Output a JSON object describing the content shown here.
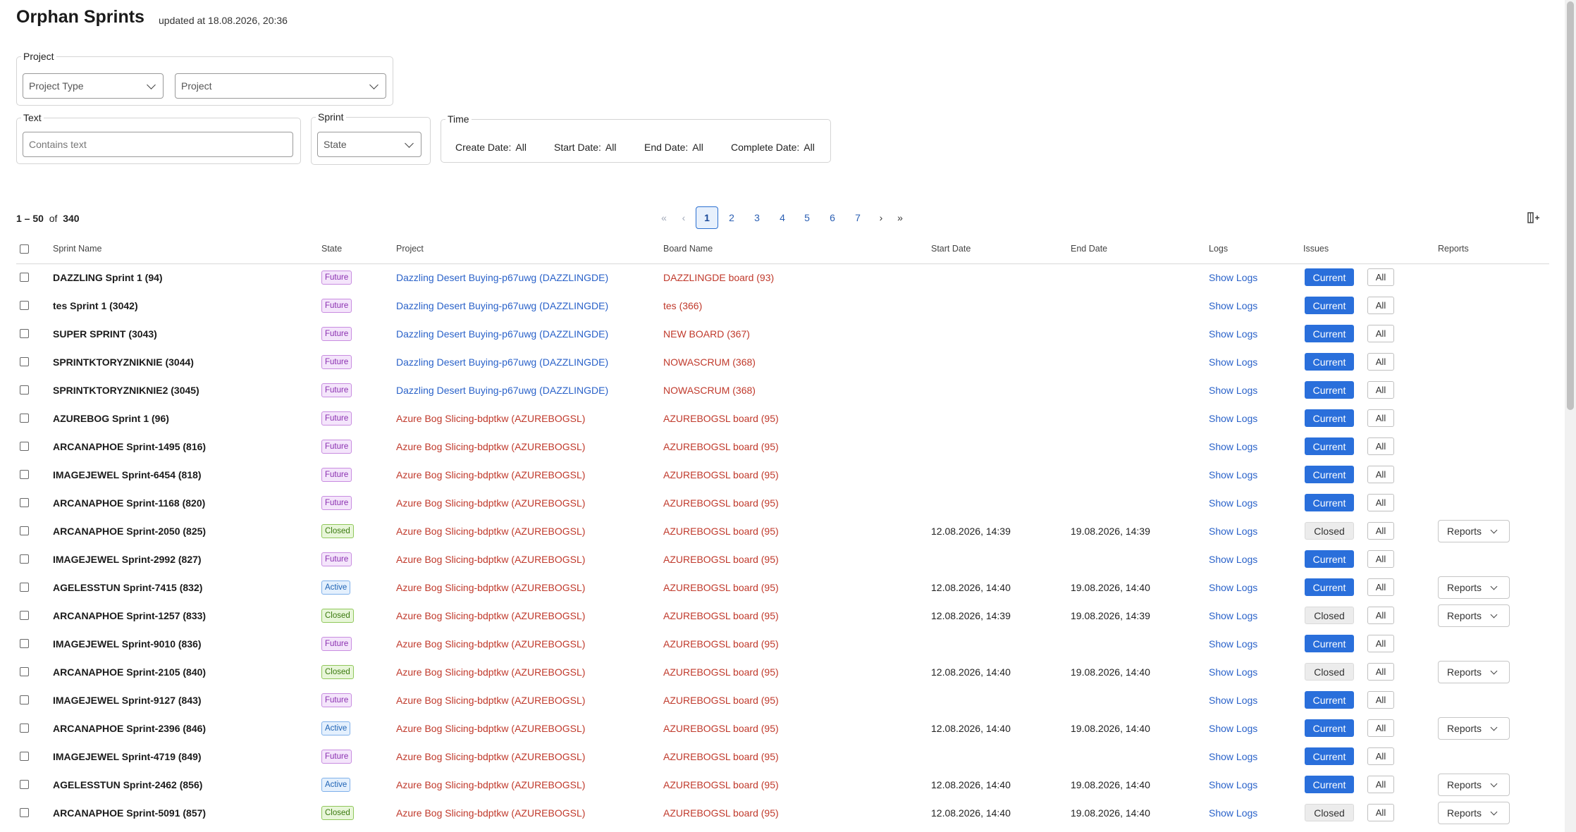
{
  "header": {
    "title": "Orphan Sprints",
    "updated": "updated at 18.08.2026, 20:36"
  },
  "filters": {
    "project": {
      "legend": "Project",
      "project_type": "Project Type",
      "project": "Project"
    },
    "text": {
      "legend": "Text",
      "placeholder": "Contains text"
    },
    "sprint": {
      "legend": "Sprint",
      "state": "State"
    },
    "time": {
      "legend": "Time",
      "items": [
        {
          "label": "Create Date:",
          "value": "All"
        },
        {
          "label": "Start Date:",
          "value": "All"
        },
        {
          "label": "End Date:",
          "value": "All"
        },
        {
          "label": "Complete Date:",
          "value": "All"
        }
      ]
    }
  },
  "pagination": {
    "range": "1 – 50",
    "of": "of",
    "total": "340",
    "pages": [
      "1",
      "2",
      "3",
      "4",
      "5",
      "6",
      "7"
    ],
    "current": "1"
  },
  "columns": {
    "name": "Sprint Name",
    "state": "State",
    "project": "Project",
    "board": "Board Name",
    "start": "Start Date",
    "end": "End Date",
    "logs": "Logs",
    "issues": "Issues",
    "reports": "Reports"
  },
  "labels": {
    "show_logs": "Show Logs",
    "current": "Current",
    "closed": "Closed",
    "all": "All",
    "reports": "Reports"
  },
  "colors": {
    "accent": "#2a6fdb",
    "link": "#2a62c9",
    "red_link": "#c0392b"
  },
  "rows": [
    {
      "name": "DAZZLING Sprint 1 (94)",
      "state": "Future",
      "project": "Dazzling Desert Buying-p67uwg (DAZZLINGDE)",
      "project_color": "blue",
      "board": "DAZZLINGDE board (93)",
      "start": "",
      "end": "",
      "issue": "Current",
      "reports": false
    },
    {
      "name": "tes Sprint 1 (3042)",
      "state": "Future",
      "project": "Dazzling Desert Buying-p67uwg (DAZZLINGDE)",
      "project_color": "blue",
      "board": "tes (366)",
      "start": "",
      "end": "",
      "issue": "Current",
      "reports": false
    },
    {
      "name": "SUPER SPRINT (3043)",
      "state": "Future",
      "project": "Dazzling Desert Buying-p67uwg (DAZZLINGDE)",
      "project_color": "blue",
      "board": "NEW BOARD (367)",
      "start": "",
      "end": "",
      "issue": "Current",
      "reports": false
    },
    {
      "name": "SPRINTKTORYZNIKNIE (3044)",
      "state": "Future",
      "project": "Dazzling Desert Buying-p67uwg (DAZZLINGDE)",
      "project_color": "blue",
      "board": "NOWASCRUM (368)",
      "start": "",
      "end": "",
      "issue": "Current",
      "reports": false
    },
    {
      "name": "SPRINTKTORYZNIKNIE2 (3045)",
      "state": "Future",
      "project": "Dazzling Desert Buying-p67uwg (DAZZLINGDE)",
      "project_color": "blue",
      "board": "NOWASCRUM (368)",
      "start": "",
      "end": "",
      "issue": "Current",
      "reports": false
    },
    {
      "name": "AZUREBOG Sprint 1 (96)",
      "state": "Future",
      "project": "Azure Bog Slicing-bdptkw (AZUREBOGSL)",
      "project_color": "red",
      "board": "AZUREBOGSL board (95)",
      "start": "",
      "end": "",
      "issue": "Current",
      "reports": false
    },
    {
      "name": "ARCANAPHOE Sprint-1495 (816)",
      "state": "Future",
      "project": "Azure Bog Slicing-bdptkw (AZUREBOGSL)",
      "project_color": "red",
      "board": "AZUREBOGSL board (95)",
      "start": "",
      "end": "",
      "issue": "Current",
      "reports": false
    },
    {
      "name": "IMAGEJEWEL Sprint-6454 (818)",
      "state": "Future",
      "project": "Azure Bog Slicing-bdptkw (AZUREBOGSL)",
      "project_color": "red",
      "board": "AZUREBOGSL board (95)",
      "start": "",
      "end": "",
      "issue": "Current",
      "reports": false
    },
    {
      "name": "ARCANAPHOE Sprint-1168 (820)",
      "state": "Future",
      "project": "Azure Bog Slicing-bdptkw (AZUREBOGSL)",
      "project_color": "red",
      "board": "AZUREBOGSL board (95)",
      "start": "",
      "end": "",
      "issue": "Current",
      "reports": false
    },
    {
      "name": "ARCANAPHOE Sprint-2050 (825)",
      "state": "Closed",
      "project": "Azure Bog Slicing-bdptkw (AZUREBOGSL)",
      "project_color": "red",
      "board": "AZUREBOGSL board (95)",
      "start": "12.08.2026, 14:39",
      "end": "19.08.2026, 14:39",
      "issue": "Closed",
      "reports": true
    },
    {
      "name": "IMAGEJEWEL Sprint-2992 (827)",
      "state": "Future",
      "project": "Azure Bog Slicing-bdptkw (AZUREBOGSL)",
      "project_color": "red",
      "board": "AZUREBOGSL board (95)",
      "start": "",
      "end": "",
      "issue": "Current",
      "reports": false
    },
    {
      "name": "AGELESSTUN Sprint-7415 (832)",
      "state": "Active",
      "project": "Azure Bog Slicing-bdptkw (AZUREBOGSL)",
      "project_color": "red",
      "board": "AZUREBOGSL board (95)",
      "start": "12.08.2026, 14:40",
      "end": "19.08.2026, 14:40",
      "issue": "Current",
      "reports": true
    },
    {
      "name": "ARCANAPHOE Sprint-1257 (833)",
      "state": "Closed",
      "project": "Azure Bog Slicing-bdptkw (AZUREBOGSL)",
      "project_color": "red",
      "board": "AZUREBOGSL board (95)",
      "start": "12.08.2026, 14:39",
      "end": "19.08.2026, 14:39",
      "issue": "Closed",
      "reports": true
    },
    {
      "name": "IMAGEJEWEL Sprint-9010 (836)",
      "state": "Future",
      "project": "Azure Bog Slicing-bdptkw (AZUREBOGSL)",
      "project_color": "red",
      "board": "AZUREBOGSL board (95)",
      "start": "",
      "end": "",
      "issue": "Current",
      "reports": false
    },
    {
      "name": "ARCANAPHOE Sprint-2105 (840)",
      "state": "Closed",
      "project": "Azure Bog Slicing-bdptkw (AZUREBOGSL)",
      "project_color": "red",
      "board": "AZUREBOGSL board (95)",
      "start": "12.08.2026, 14:40",
      "end": "19.08.2026, 14:40",
      "issue": "Closed",
      "reports": true
    },
    {
      "name": "IMAGEJEWEL Sprint-9127 (843)",
      "state": "Future",
      "project": "Azure Bog Slicing-bdptkw (AZUREBOGSL)",
      "project_color": "red",
      "board": "AZUREBOGSL board (95)",
      "start": "",
      "end": "",
      "issue": "Current",
      "reports": false
    },
    {
      "name": "ARCANAPHOE Sprint-2396 (846)",
      "state": "Active",
      "project": "Azure Bog Slicing-bdptkw (AZUREBOGSL)",
      "project_color": "red",
      "board": "AZUREBOGSL board (95)",
      "start": "12.08.2026, 14:40",
      "end": "19.08.2026, 14:40",
      "issue": "Current",
      "reports": true
    },
    {
      "name": "IMAGEJEWEL Sprint-4719 (849)",
      "state": "Future",
      "project": "Azure Bog Slicing-bdptkw (AZUREBOGSL)",
      "project_color": "red",
      "board": "AZUREBOGSL board (95)",
      "start": "",
      "end": "",
      "issue": "Current",
      "reports": false
    },
    {
      "name": "AGELESSTUN Sprint-2462 (856)",
      "state": "Active",
      "project": "Azure Bog Slicing-bdptkw (AZUREBOGSL)",
      "project_color": "red",
      "board": "AZUREBOGSL board (95)",
      "start": "12.08.2026, 14:40",
      "end": "19.08.2026, 14:40",
      "issue": "Current",
      "reports": true
    },
    {
      "name": "ARCANAPHOE Sprint-5091 (857)",
      "state": "Closed",
      "project": "Azure Bog Slicing-bdptkw (AZUREBOGSL)",
      "project_color": "red",
      "board": "AZUREBOGSL board (95)",
      "start": "12.08.2026, 14:40",
      "end": "19.08.2026, 14:40",
      "issue": "Closed",
      "reports": true
    }
  ]
}
